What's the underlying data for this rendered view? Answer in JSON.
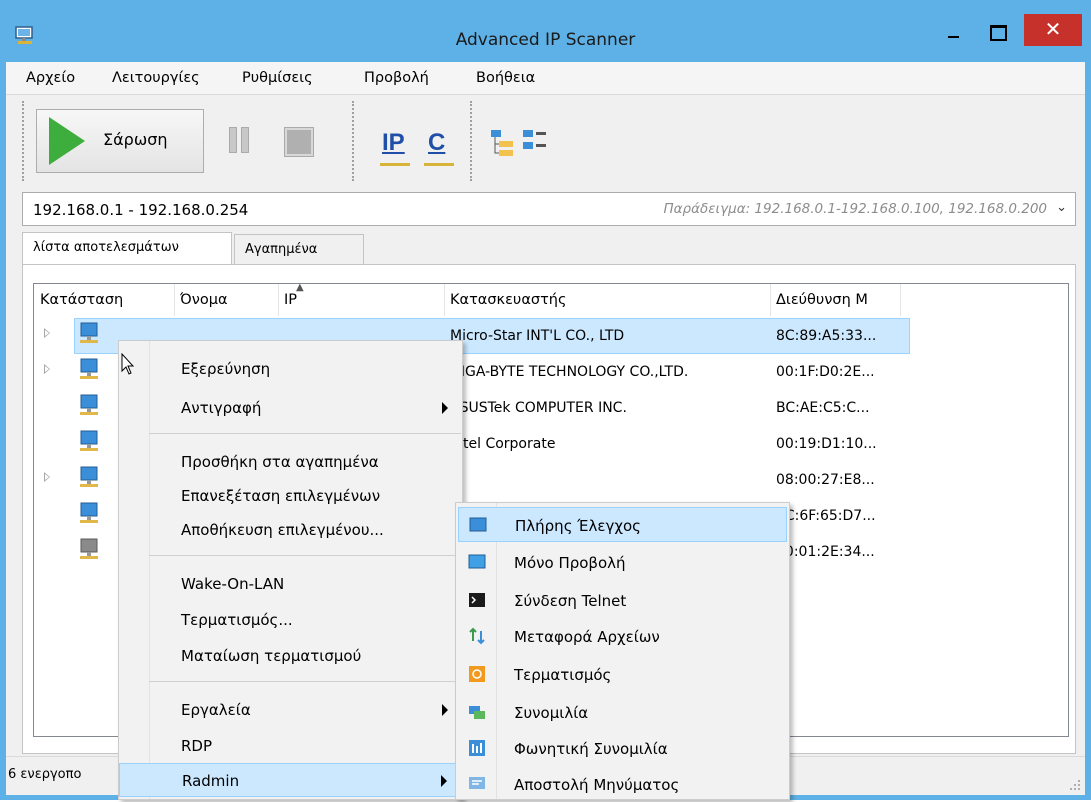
{
  "window": {
    "title": "Advanced IP Scanner"
  },
  "menu": [
    "Αρχείο",
    "Λειτουργίες",
    "Ρυθμίσεις",
    "Προβολή",
    "Βοήθεια"
  ],
  "toolbar": {
    "scan_label": "Σάρωση",
    "ip_label": "IP",
    "c_label": "C"
  },
  "address": {
    "value": "192.168.0.1 - 192.168.0.254",
    "hint": "Παράδειγμα: 192.168.0.1-192.168.0.100, 192.168.0.200"
  },
  "tabs": [
    "λίστα αποτελεσμάτων",
    "Αγαπημένα"
  ],
  "columns": [
    "Κατάσταση",
    "Όνομα",
    "IP",
    "Κατασκευαστής",
    "Διεύθυνση M"
  ],
  "rows": [
    {
      "manufacturer": "Micro-Star INT'L CO., LTD",
      "mac": "8C:89:A5:33..."
    },
    {
      "manufacturer": "GIGA-BYTE TECHNOLOGY CO.,LTD.",
      "mac": "00:1F:D0:2E..."
    },
    {
      "manufacturer": "ASUSTek COMPUTER INC.",
      "mac": "BC:AE:C5:C..."
    },
    {
      "manufacturer": "Intel Corporate",
      "mac": "00:19:D1:10..."
    },
    {
      "manufacturer": "",
      "mac": "08:00:27:E8..."
    },
    {
      "manufacturer": "",
      "mac": "9C:6F:65:D7..."
    },
    {
      "manufacturer": "",
      "mac": "00:01:2E:34..."
    }
  ],
  "status": {
    "text": "6 ενεργοπο"
  },
  "context_menu": {
    "explore": "Εξερεύνηση",
    "copy": "Αντιγραφή",
    "add_fav": "Προσθήκη στα αγαπημένα",
    "rescan": "Επανεξέταση επιλεγμένων",
    "save": "Αποθήκευση επιλεγμένου...",
    "wol": "Wake-On-LAN",
    "shutdown": "Τερματισμός...",
    "abort_shutdown": "Ματαίωση τερματισμού",
    "tools": "Εργαλεία",
    "rdp": "RDP",
    "radmin": "Radmin"
  },
  "submenu": {
    "full_control": "Πλήρης Έλεγχος",
    "view_only": "Μόνο Προβολή",
    "telnet": "Σύνδεση Telnet",
    "file_transfer": "Μεταφορά Αρχείων",
    "shutdown": "Τερματισμός",
    "chat": "Συνομιλία",
    "voice_chat": "Φωνητική Συνομιλία",
    "send_message": "Αποστολή Μηνύματος"
  },
  "colors": {
    "titlebar": "#5eb1e6",
    "close": "#c7312c",
    "selection": "#cce8ff",
    "play": "#3dae3d",
    "link_blue": "#1f4fa8"
  }
}
